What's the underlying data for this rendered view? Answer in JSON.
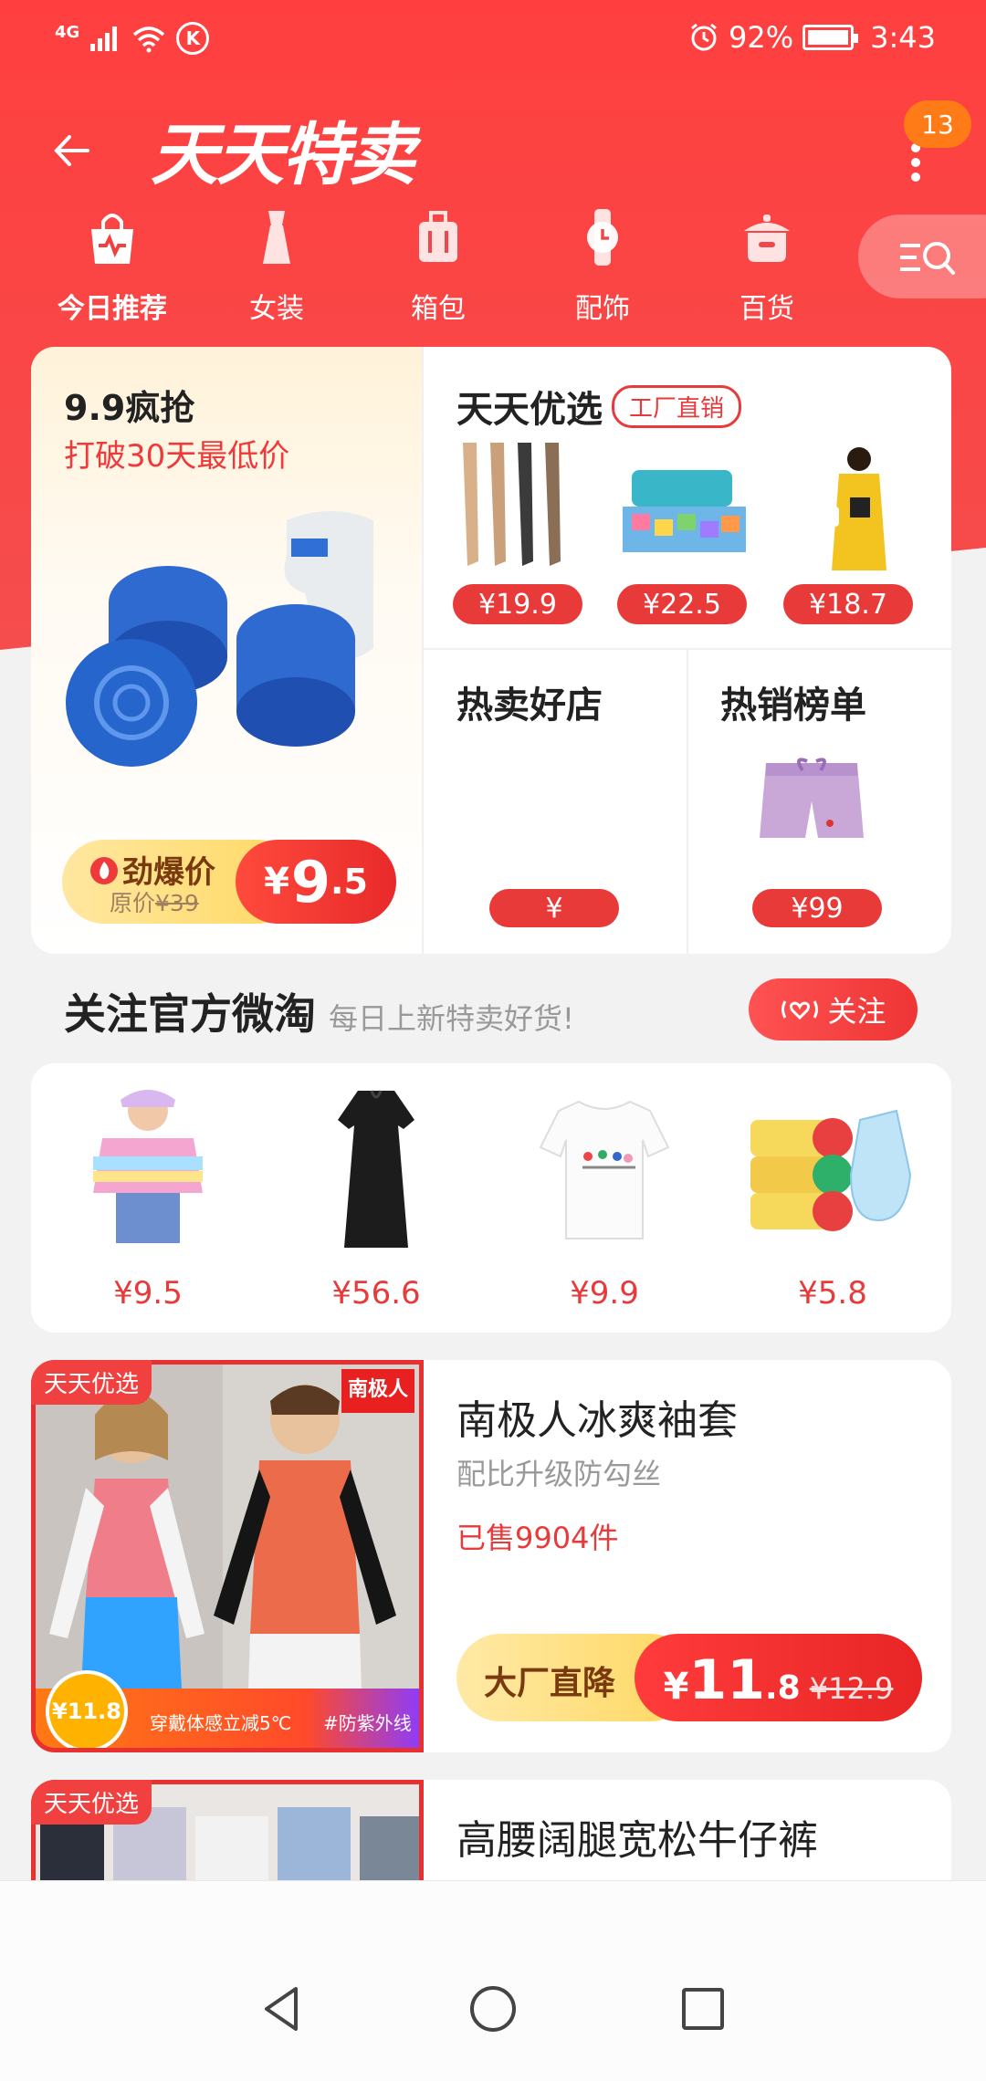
{
  "status_bar": {
    "network": "4G",
    "battery_percent": "92%",
    "time": "3:43",
    "k_icon": "K"
  },
  "header": {
    "title": "天天特卖",
    "notification_count": "13"
  },
  "categories": [
    {
      "label": "今日推荐",
      "icon": "shopping-bag-icon",
      "active": true
    },
    {
      "label": "女装",
      "icon": "dress-icon",
      "active": false
    },
    {
      "label": "箱包",
      "icon": "luggage-icon",
      "active": false
    },
    {
      "label": "配饰",
      "icon": "watch-icon",
      "active": false
    },
    {
      "label": "百货",
      "icon": "pot-icon",
      "active": false
    }
  ],
  "flash_deal": {
    "title": "9.9疯抢",
    "subtitle": "打破30天最低价",
    "label": "劲爆价",
    "original_prefix": "原价",
    "original_price": "¥39",
    "price_currency": "¥",
    "price_int": "9",
    "price_dec": ".5"
  },
  "daily_picks": {
    "title": "天天优选",
    "tag": "工厂直销",
    "prices": [
      "¥19.9",
      "¥22.5",
      "¥18.7"
    ]
  },
  "hot_shops": {
    "title": "热卖好店",
    "price": "¥"
  },
  "hot_list": {
    "title": "热销榜单",
    "price": "¥99"
  },
  "follow": {
    "title": "关注官方微淘",
    "subtitle": "每日上新特卖好货!",
    "button": "关注",
    "prices": [
      "¥9.5",
      "¥56.6",
      "¥9.9",
      "¥5.8"
    ]
  },
  "products": [
    {
      "tag": "天天优选",
      "title": "南极人冰爽袖套",
      "subtitle": "配比升级防勾丝",
      "sold": "已售9904件",
      "label": "大厂直降",
      "price_currency": "¥",
      "price_int": "11",
      "price_dec": ".8",
      "original_price": "¥12.9",
      "brand": "南极人",
      "badge_price": "¥11.8",
      "banner_text": "穿戴体感立减5℃",
      "banner_text2": "#防紫外线"
    },
    {
      "tag": "天天优选",
      "title": "高腰阔腿宽松牛仔裤"
    }
  ],
  "colors": {
    "brand_red": "#ff3f3f",
    "price_red": "#e93a3a",
    "accent_orange": "#ff7b17"
  }
}
